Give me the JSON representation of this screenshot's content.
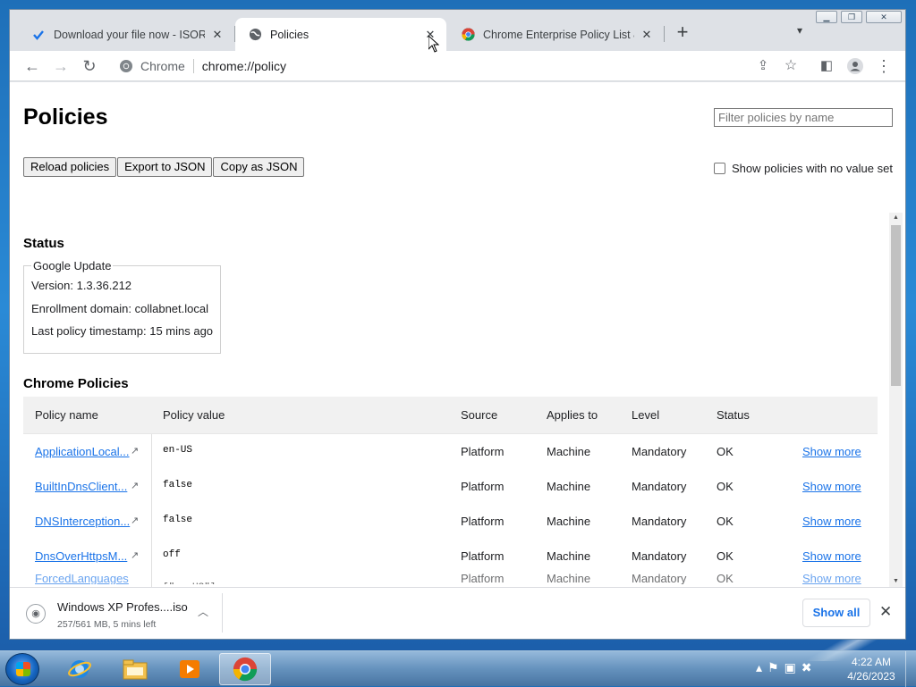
{
  "browser": {
    "tabs": [
      {
        "title": "Download your file now - ISORIV",
        "icon": "check-icon"
      },
      {
        "title": "Policies",
        "icon": "globe-icon"
      },
      {
        "title": "Chrome Enterprise Policy List & M",
        "icon": "chrome-icon"
      }
    ],
    "omnibox": {
      "chip": "Chrome",
      "url": "chrome://policy"
    }
  },
  "page": {
    "title": "Policies",
    "filter_placeholder": "Filter policies by name",
    "buttons": {
      "reload": "Reload policies",
      "export": "Export to JSON",
      "copy": "Copy as JSON"
    },
    "show_unset_label": "Show policies with no value set",
    "status": {
      "heading": "Status",
      "box_legend": "Google Update",
      "version": "Version: 1.3.36.212",
      "enrollment": "Enrollment domain: collabnet.local",
      "timestamp": "Last policy timestamp: 15 mins ago"
    },
    "chrome_policies": {
      "heading": "Chrome Policies",
      "columns": [
        "Policy name",
        "Policy value",
        "Source",
        "Applies to",
        "Level",
        "Status"
      ],
      "rows": [
        {
          "name": "ApplicationLocal...",
          "value": "en-US",
          "source": "Platform",
          "applies": "Machine",
          "level": "Mandatory",
          "status": "OK",
          "action": "Show more"
        },
        {
          "name": "BuiltInDnsClient...",
          "value": "false",
          "source": "Platform",
          "applies": "Machine",
          "level": "Mandatory",
          "status": "OK",
          "action": "Show more"
        },
        {
          "name": "DNSInterception...",
          "value": "false",
          "source": "Platform",
          "applies": "Machine",
          "level": "Mandatory",
          "status": "OK",
          "action": "Show more"
        },
        {
          "name": "DnsOverHttpsM...",
          "value": "off",
          "source": "Platform",
          "applies": "Machine",
          "level": "Mandatory",
          "status": "OK",
          "action": "Show more"
        },
        {
          "name": "ForcedLanguages",
          "value": "[\"en-US\"]",
          "source": "Platform",
          "applies": "Machine",
          "level": "Mandatory",
          "status": "OK",
          "action": "Show more"
        }
      ]
    }
  },
  "downloads": {
    "item_name": "Windows XP Profes....iso",
    "item_meta": "257/561 MB, 5 mins left",
    "show_all": "Show all"
  },
  "taskbar": {
    "time": "4:22 AM",
    "date": "4/26/2023"
  }
}
